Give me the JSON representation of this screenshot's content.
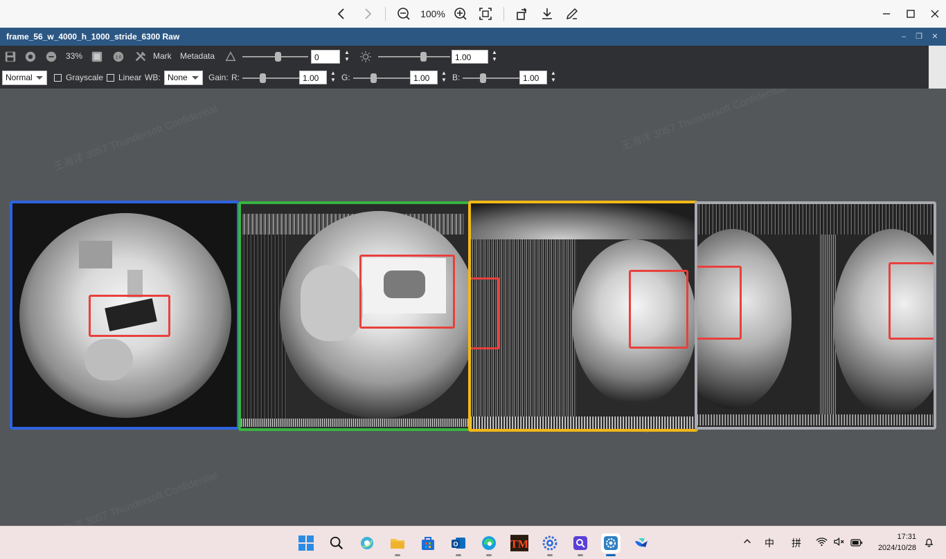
{
  "viewer": {
    "zoom": "100%",
    "buttons": [
      "back",
      "forward",
      "zoom-out",
      "zoom-in",
      "fit",
      "rotate",
      "download",
      "edit"
    ]
  },
  "app": {
    "title": "frame_56_w_4000_h_1000_stride_6300 Raw"
  },
  "toolbar1": {
    "zoom_label": "33%",
    "mark_label": "Mark",
    "metadata_label": "Metadata",
    "contrast_value": "0",
    "brightness_value": "1.00"
  },
  "toolbar2": {
    "mode": "Normal",
    "grayscale_label": "Grayscale",
    "linear_label": "Linear",
    "wb_label": "WB:",
    "wb_value": "None",
    "gain_label": "Gain:",
    "r_label": "R:",
    "r_value": "1.00",
    "g_label": "G:",
    "g_value": "1.00",
    "b_label": "B:",
    "b_value": "1.00"
  },
  "watermark_text": "王海洋 3057 Thundersoft Confidential",
  "frames": [
    {
      "border_color": "#2f63e0"
    },
    {
      "border_color": "#38b441"
    },
    {
      "border_color": "#f2b816"
    },
    {
      "border_color": "#a8aab0"
    }
  ],
  "taskbar": {
    "ime_mode": "中",
    "ime_name": "拼",
    "time": "17:31",
    "date": "2024/10/28"
  }
}
